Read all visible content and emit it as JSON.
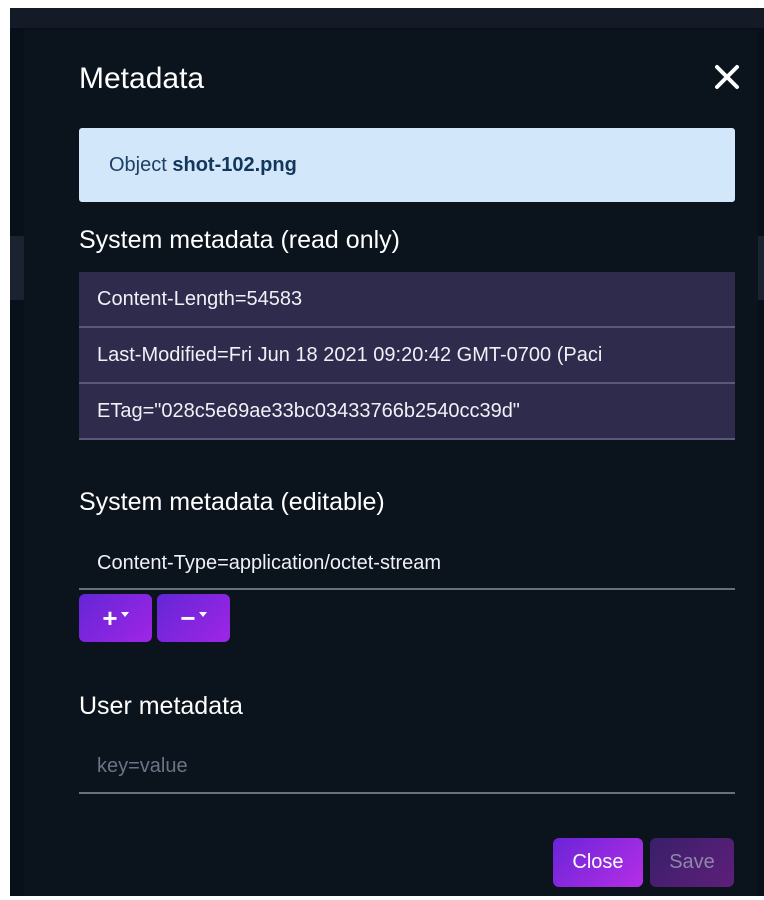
{
  "dialog": {
    "title": "Metadata",
    "close_icon": "close-icon"
  },
  "object_banner": {
    "prefix": "Object",
    "name": "shot-102.png"
  },
  "system_readonly": {
    "heading": "System metadata (read only)",
    "rows": [
      "Content-Length=54583",
      "Last-Modified=Fri Jun 18 2021 09:20:42 GMT-0700 (Paci",
      "ETag=\"028c5e69ae33bc03433766b2540cc39d\""
    ]
  },
  "system_editable": {
    "heading": "System metadata (editable)",
    "value": "Content-Type=application/octet-stream",
    "add_label": "+",
    "remove_label": "−"
  },
  "user_metadata": {
    "heading": "User metadata",
    "placeholder": "key=value",
    "value": ""
  },
  "footer": {
    "close_label": "Close",
    "save_label": "Save"
  },
  "colors": {
    "background": "#0b131d",
    "banner": "#d3e7fa",
    "readonly_row": "#2f2b4d",
    "accent_start": "#6326d6",
    "accent_end": "#a025e6"
  }
}
